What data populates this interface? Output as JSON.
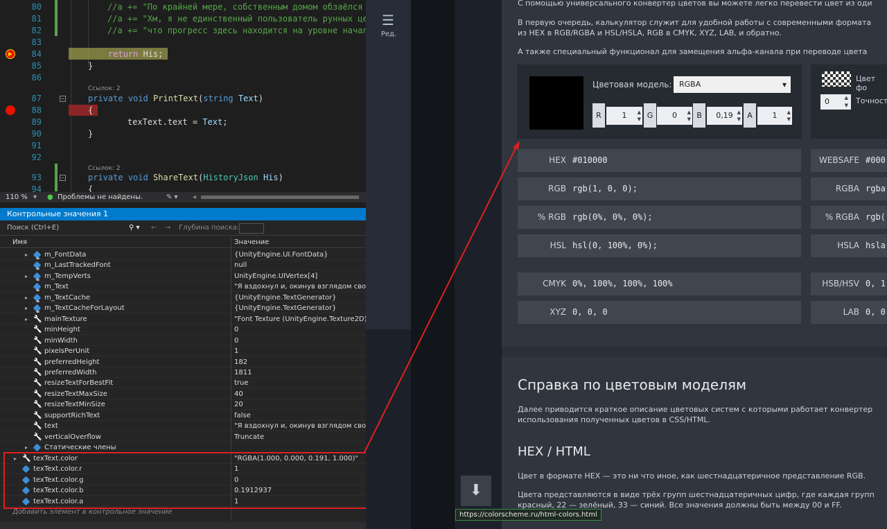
{
  "editor": {
    "lines": [
      {
        "n": "80",
        "parts": [
          [
            "c",
            "//a += \"По крайней мере, собственным домом обзаёлся"
          ]
        ]
      },
      {
        "n": "81",
        "parts": [
          [
            "c",
            "//a += \"Хм, я не единственный пользователь рунных це"
          ]
        ]
      },
      {
        "n": "82",
        "parts": [
          [
            "c",
            "//a += \"что прогресс здесь находится на уровне начал"
          ]
        ]
      },
      {
        "n": "83",
        "parts": []
      },
      {
        "n": "84",
        "parts": [
          [
            "kc",
            "    return"
          ],
          [
            "",
            " His;"
          ]
        ]
      },
      {
        "n": "85",
        "parts": [
          [
            "",
            "}"
          ]
        ]
      },
      {
        "n": "86",
        "parts": []
      },
      {
        "n": "87",
        "parts": [
          [
            "k",
            "private"
          ],
          [
            "",
            " "
          ],
          [
            "k",
            "void"
          ],
          [
            "",
            " "
          ],
          [
            "m",
            "PrintText"
          ],
          [
            "",
            "("
          ],
          [
            "k",
            "string"
          ],
          [
            "",
            " "
          ],
          [
            "p",
            "Text"
          ],
          [
            "",
            ")"
          ]
        ]
      },
      {
        "n": "88",
        "parts": [
          [
            "",
            "{"
          ]
        ]
      },
      {
        "n": "89",
        "parts": [
          [
            "",
            "    texText.text = "
          ],
          [
            "p",
            "Text"
          ],
          [
            "",
            ";"
          ]
        ]
      },
      {
        "n": "90",
        "parts": [
          [
            "",
            "}"
          ]
        ]
      },
      {
        "n": "91",
        "parts": []
      },
      {
        "n": "92",
        "parts": []
      },
      {
        "n": "93",
        "parts": [
          [
            "k",
            "private"
          ],
          [
            "",
            " "
          ],
          [
            "k",
            "void"
          ],
          [
            "",
            " "
          ],
          [
            "m",
            "ShareText"
          ],
          [
            "",
            "("
          ],
          [
            "t",
            "HistoryJson"
          ],
          [
            "",
            " "
          ],
          [
            "p",
            "His"
          ],
          [
            "",
            ")"
          ]
        ]
      },
      {
        "n": "94",
        "parts": [
          [
            "",
            "{"
          ]
        ]
      }
    ],
    "refs_1": "Ссылок: 2",
    "refs_2": "Ссылок: 2"
  },
  "status": {
    "zoom": "110 %",
    "problems": "Проблемы не найдены."
  },
  "watch": {
    "title": "Контрольные значения 1",
    "search_placeholder": "Поиск (Ctrl+E)",
    "depth_label": "Глубина поиска:",
    "col_name": "Имя",
    "col_value": "Значение",
    "add_hint": "Добавить элемент в контрольное значение",
    "rows": [
      {
        "name": "m_FontData",
        "value": "{UnityEngine.UI.FontData}",
        "exp": true,
        "icon": "field-lock"
      },
      {
        "name": "m_LastTrackedFont",
        "value": "null",
        "exp": false,
        "icon": "field-lock"
      },
      {
        "name": "m_TempVerts",
        "value": "UnityEngine.UIVertex[4]",
        "exp": true,
        "icon": "field-lock"
      },
      {
        "name": "m_Text",
        "value": "\"Я вздохнул и, окинув взглядом своё н",
        "exp": false,
        "icon": "field-lock"
      },
      {
        "name": "m_TextCache",
        "value": "{UnityEngine.TextGenerator}",
        "exp": true,
        "icon": "field-lock"
      },
      {
        "name": "m_TextCacheForLayout",
        "value": "{UnityEngine.TextGenerator}",
        "exp": true,
        "icon": "field-lock"
      },
      {
        "name": "mainTexture",
        "value": "\"Font Texture (UnityEngine.Texture2D)\"",
        "exp": true,
        "icon": "prop"
      },
      {
        "name": "minHeight",
        "value": "0",
        "exp": false,
        "icon": "prop"
      },
      {
        "name": "minWidth",
        "value": "0",
        "exp": false,
        "icon": "prop"
      },
      {
        "name": "pixelsPerUnit",
        "value": "1",
        "exp": false,
        "icon": "prop"
      },
      {
        "name": "preferredHeight",
        "value": "182",
        "exp": false,
        "icon": "prop"
      },
      {
        "name": "preferredWidth",
        "value": "1811",
        "exp": false,
        "icon": "prop"
      },
      {
        "name": "resizeTextForBestFit",
        "value": "true",
        "exp": false,
        "icon": "prop"
      },
      {
        "name": "resizeTextMaxSize",
        "value": "40",
        "exp": false,
        "icon": "prop"
      },
      {
        "name": "resizeTextMinSize",
        "value": "20",
        "exp": false,
        "icon": "prop"
      },
      {
        "name": "supportRichText",
        "value": "false",
        "exp": false,
        "icon": "prop"
      },
      {
        "name": "text",
        "value": "\"Я вздохнул и, окинув взглядом своё нынешнее обиталище, хмы",
        "exp": false,
        "icon": "prop"
      },
      {
        "name": "verticalOverflow",
        "value": "Truncate",
        "exp": false,
        "icon": "prop"
      },
      {
        "name": "Статические члены",
        "value": "",
        "exp": true,
        "icon": "field"
      }
    ],
    "top_rows": [
      {
        "name": "texText.color",
        "value": "\"RGBA(1.000, 0.000, 0.191, 1.000)\"",
        "exp": true,
        "icon": "prop"
      },
      {
        "name": "texText.color.r",
        "value": "1",
        "exp": false,
        "icon": "field"
      },
      {
        "name": "texText.color.g",
        "value": "0",
        "exp": false,
        "icon": "field"
      },
      {
        "name": "texText.color.b",
        "value": "0.1912937",
        "exp": false,
        "icon": "field"
      },
      {
        "name": "texText.color.a",
        "value": "1",
        "exp": false,
        "icon": "field"
      }
    ]
  },
  "middle": {
    "toc_label": "Ред.",
    "url": "https://colorscheme.ru/html-colors.html"
  },
  "web": {
    "intro_1": "С помощью универсального конвертер цветов вы можете легко перевести цвет из оди",
    "intro_2a": "В первую очередь, калькулятор служит для удобной работы с современными формата",
    "intro_2b": "из HEX в RGB/RGBA и HSL/HSLA, RGB в CMYK, XYZ, LAB, и обратно.",
    "intro_3": "А также специальный функционал для замещения альфа-канала при переводе цвета",
    "model_label": "Цветовая модель:",
    "model_value": "RGBA",
    "channels": [
      {
        "label": "R",
        "value": "1"
      },
      {
        "label": "G",
        "value": "0"
      },
      {
        "label": "B",
        "value": "0,19"
      },
      {
        "label": "A",
        "value": "1"
      }
    ],
    "bg_label": "Цвет фо",
    "precision_value": "0",
    "precision_label": "Точност",
    "formats_left": [
      {
        "k": "HEX",
        "v": "#010000"
      },
      {
        "k": "RGB",
        "v": "rgb(1, 0, 0);"
      },
      {
        "k": "% RGB",
        "v": "rgb(0%, 0%, 0%);"
      },
      {
        "k": "HSL",
        "v": "hsl(0, 100%, 0%);"
      },
      {
        "k": "CMYK",
        "v": "0%, 100%, 100%, 100%"
      },
      {
        "k": "XYZ",
        "v": "0, 0, 0"
      }
    ],
    "formats_right": [
      {
        "k": "WEBSAFE",
        "v": "#000"
      },
      {
        "k": "RGBA",
        "v": "rgba"
      },
      {
        "k": "% RGBA",
        "v": "rgb("
      },
      {
        "k": "HSLA",
        "v": "hsla"
      },
      {
        "k": "HSB/HSV",
        "v": "0, 1"
      },
      {
        "k": "LAB",
        "v": "0, 0"
      }
    ],
    "help_title": "Справка по цветовым моделям",
    "help_1": "Далее приводится краткое описание цветовых систем с которыми работает конвертер",
    "help_2": "использования полученных цветов в CSS/HTML.",
    "hex_title": "HEX / HTML",
    "hex_1": "Цвет в формате HEX — это ни что иное, как шестнадцатеричное представление RGB.",
    "hex_2": "Цвета представляются в виде трёх групп шестнадцатеричных цифр, где каждая групп",
    "hex_3": "красный, 22 — зелёный, 33 — синий. Все значения должны быть между 00 и FF."
  },
  "colors": {
    "vs_blue": "#007acc",
    "annotation_red": "#e0201e",
    "swatch": "#010000"
  }
}
